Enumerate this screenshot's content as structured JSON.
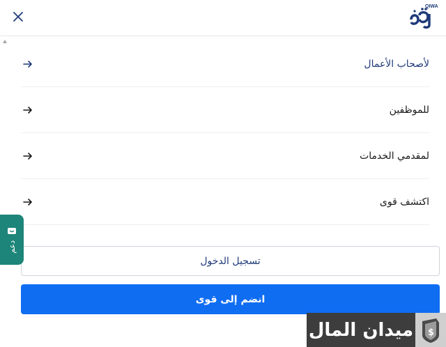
{
  "header": {
    "logo_text": "QIWA",
    "logo_glyph": "قوى",
    "close_icon": "close-icon",
    "accent_color": "#1f3a7a"
  },
  "menu": {
    "items": [
      {
        "label": "لأصحاب الأعمال",
        "icon": "arrow-right-icon",
        "active": true
      },
      {
        "label": "للموظفين",
        "icon": "arrow-right-icon",
        "active": false
      },
      {
        "label": "لمقدمي الخدمات",
        "icon": "arrow-right-icon",
        "active": false
      },
      {
        "label": "اكتشف قوى",
        "icon": "arrow-right-icon",
        "active": false
      }
    ]
  },
  "actions": {
    "login_label": "تسجيل الدخول",
    "join_label": "انضم إلى قوى",
    "join_color": "#0f6df2"
  },
  "side_tab": {
    "label": "دعم",
    "icon": "chat-icon",
    "color": "#1d8579"
  },
  "watermark": {
    "text": "ميدان المال",
    "icon": "shield-dollar-icon"
  }
}
